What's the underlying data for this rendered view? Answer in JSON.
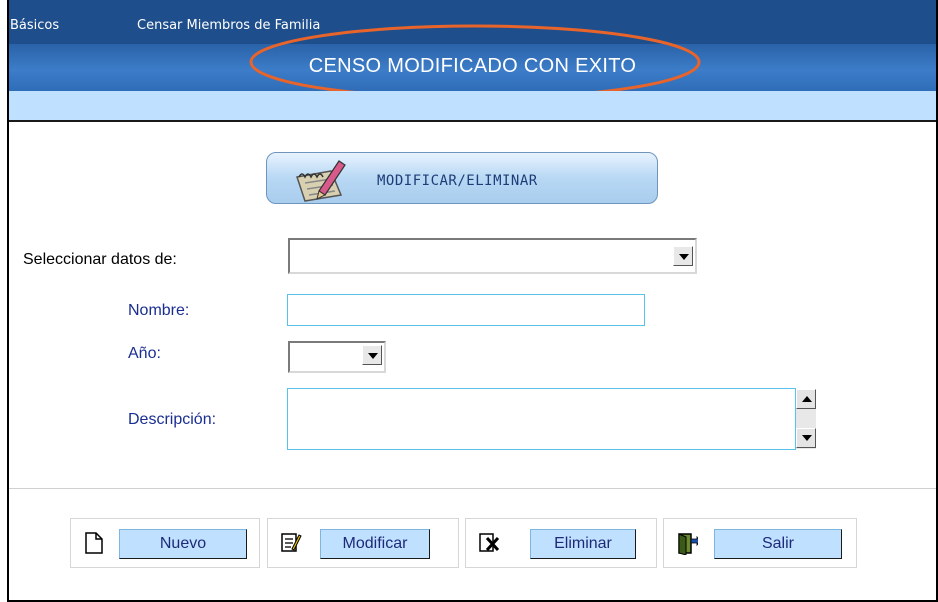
{
  "menu": {
    "items": [
      "Básicos",
      "Censar Miembros de Familia"
    ]
  },
  "banner": {
    "message": "CENSO MODIFICADO CON EXITO"
  },
  "header_button": {
    "label": "MODIFICAR/ELIMINAR",
    "icon": "notepad-pencil-icon"
  },
  "form": {
    "select_label": "Seleccionar datos de:",
    "select_value": "",
    "nombre_label": "Nombre:",
    "nombre_value": "",
    "anio_label": "Año:",
    "anio_value": "",
    "descripcion_label": "Descripción:",
    "descripcion_value": ""
  },
  "actions": [
    {
      "label": "Nuevo",
      "icon": "new-document-icon"
    },
    {
      "label": "Modificar",
      "icon": "edit-document-icon"
    },
    {
      "label": "Eliminar",
      "icon": "delete-document-icon"
    },
    {
      "label": "Salir",
      "icon": "exit-door-icon"
    }
  ],
  "colors": {
    "menubar": "#1e4f8c",
    "accent": "#bfe0ff",
    "label_blue": "#1a2e90",
    "highlight_oval": "#e8642a"
  }
}
